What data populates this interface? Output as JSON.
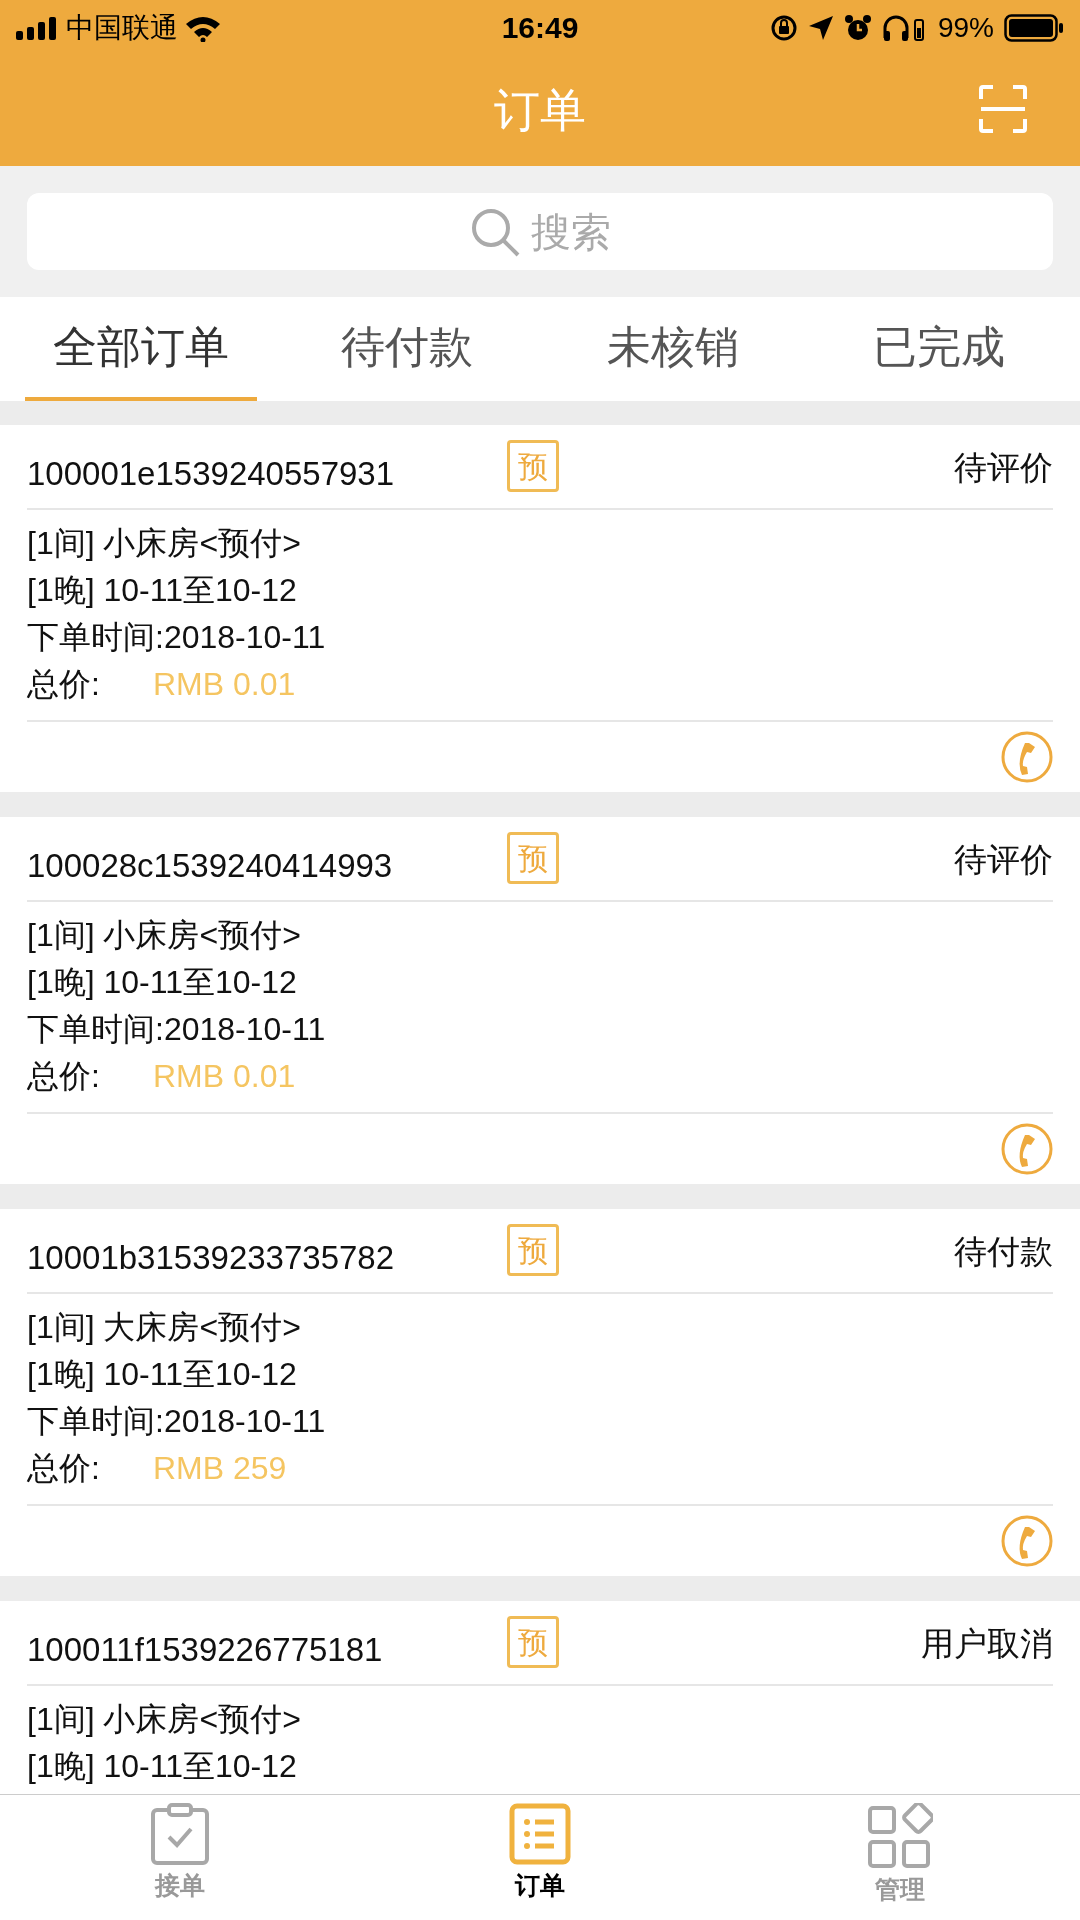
{
  "status_bar": {
    "carrier": "中国联通",
    "time": "16:49",
    "battery": "99%"
  },
  "header": {
    "title": "订单"
  },
  "search": {
    "placeholder": "搜索"
  },
  "tabs": [
    {
      "label": "全部订单",
      "selected": true
    },
    {
      "label": "待付款",
      "selected": false
    },
    {
      "label": "未核销",
      "selected": false
    },
    {
      "label": "已完成",
      "selected": false
    }
  ],
  "orders": [
    {
      "id": "100001e1539240557931",
      "badge": "预",
      "status": "待评价",
      "lines": [
        "[1间] 小床房<预付>",
        "[1晚] 10-11至10-12",
        "下单时间:2018-10-11"
      ],
      "price_label": "总价:",
      "price": "RMB 0.01"
    },
    {
      "id": "100028c1539240414993",
      "badge": "预",
      "status": "待评价",
      "lines": [
        "[1间] 小床房<预付>",
        "[1晚] 10-11至10-12",
        "下单时间:2018-10-11"
      ],
      "price_label": "总价:",
      "price": "RMB 0.01"
    },
    {
      "id": "10001b31539233735782",
      "badge": "预",
      "status": "待付款",
      "lines": [
        "[1间] 大床房<预付>",
        "[1晚] 10-11至10-12",
        "下单时间:2018-10-11"
      ],
      "price_label": "总价:",
      "price": "RMB 259"
    },
    {
      "id": "100011f1539226775181",
      "badge": "预",
      "status": "用户取消",
      "lines": [
        "[1间] 小床房<预付>",
        "[1晚] 10-11至10-12"
      ]
    }
  ],
  "tab_bar": [
    {
      "label": "接单",
      "kind": "clipboard",
      "selected": false
    },
    {
      "label": "订单",
      "kind": "list",
      "selected": true
    },
    {
      "label": "管理",
      "kind": "grid",
      "selected": false
    }
  ]
}
